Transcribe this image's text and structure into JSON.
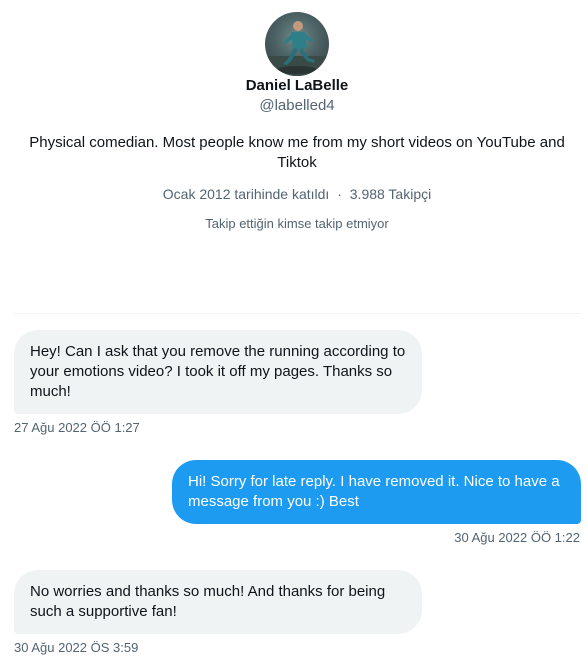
{
  "profile": {
    "name": "Daniel LaBelle",
    "handle": "@labelled4",
    "bio": "Physical comedian. Most people know me from my short videos on YouTube and Tiktok",
    "joined": "Ocak 2012 tarihinde katıldı",
    "separator": "·",
    "followers": "3.988 Takipçi",
    "follow_note": "Takip ettiğin kimse takip etmiyor"
  },
  "messages": [
    {
      "direction": "received",
      "text": "Hey! Can I ask that you remove the running according to your emotions video? I took it off my pages. Thanks so much!",
      "time": "27 Ağu 2022 ÖÖ 1:27"
    },
    {
      "direction": "sent",
      "text": "Hi! Sorry for late reply. I have removed it. Nice to have a message from you :) Best",
      "time": "30 Ağu 2022 ÖÖ 1:22"
    },
    {
      "direction": "received",
      "text": "No worries and thanks so much! And thanks for being such a supportive fan!",
      "time": "30 Ağu 2022 ÖS 3:59"
    }
  ],
  "colors": {
    "received_bubble": "#eff3f4",
    "sent_bubble": "#1d9bf0",
    "secondary_text": "#536471",
    "primary_text": "#0f1419"
  },
  "icons": {
    "avatar": "profile-photo-running-man"
  }
}
